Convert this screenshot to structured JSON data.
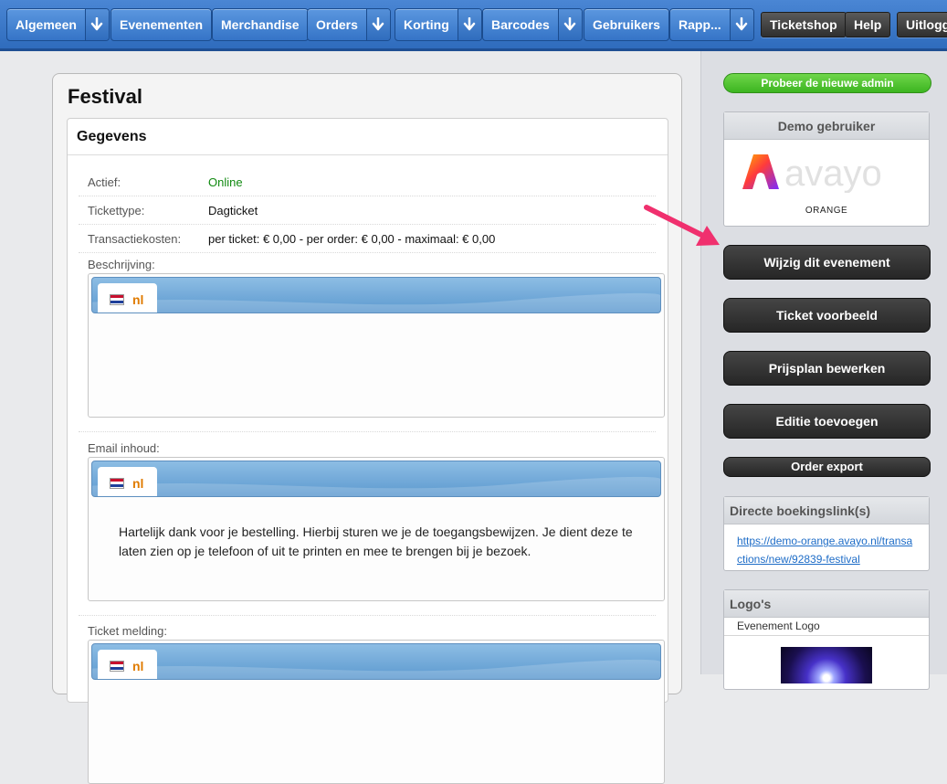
{
  "nav": {
    "algemeen": "Algemeen",
    "evenementen": "Evenementen",
    "merchandise": "Merchandise",
    "orders": "Orders",
    "korting": "Korting",
    "barcodes": "Barcodes",
    "gebruikers": "Gebruikers",
    "rapportages": "Rapp...",
    "ticketshop": "Ticketshop",
    "help": "Help",
    "uitloggen": "Uitloggen",
    "dropdown_icon": "arrow-down-icon"
  },
  "main": {
    "title": "Festival",
    "card_title": "Gegevens",
    "fields": [
      {
        "key": "Actief:",
        "value": "Online",
        "value_color": "#118a11"
      },
      {
        "key": "Tickettype:",
        "value": "Dagticket"
      },
      {
        "key": "Transactiekosten:",
        "value": "per ticket: € 0,00 - per order: € 0,00 - maximaal: € 0,00"
      }
    ],
    "sections": [
      {
        "label": "Beschrijving:",
        "lang": "nl",
        "content": ""
      },
      {
        "label": "Email inhoud:",
        "lang": "nl",
        "content": "Hartelijk dank voor je bestelling. Hierbij sturen we je de toegangsbewijzen. Je dient deze te laten zien op je telefoon of uit te printen en mee te brengen bij je bezoek."
      },
      {
        "label": "Ticket melding:",
        "lang": "nl",
        "content": ""
      }
    ]
  },
  "sidebar": {
    "try_new_admin": "Probeer de nieuwe admin",
    "demo_user_title": "Demo gebruiker",
    "brand_name": "avayo",
    "brand_sub": "ORANGE",
    "actions": [
      "Wijzig dit evenement",
      "Ticket voorbeeld",
      "Prijsplan bewerken",
      "Editie toevoegen",
      "Order export"
    ],
    "booking_links_title": "Directe boekingslink(s)",
    "booking_link": "https://demo-orange.avayo.nl/transactions/new/92839-festival",
    "logos_title": "Logo's",
    "event_logo_label": "Evenement Logo"
  },
  "colors": {
    "nav_blue": "#3574c7",
    "online_green": "#118a11",
    "accent_arrow": "#f0306e",
    "green_button": "#3cb521",
    "dark_button": "#262626",
    "lang_code": "#e07b00"
  }
}
